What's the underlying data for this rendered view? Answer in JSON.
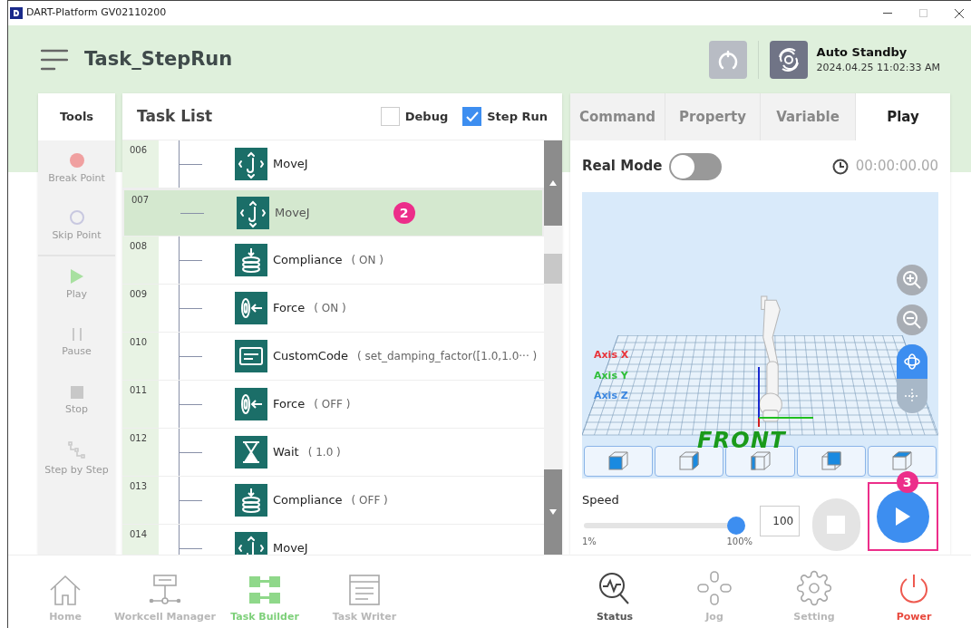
{
  "window": {
    "title": "DART-Platform GV02110200"
  },
  "header": {
    "title": "Task_StepRun",
    "status": {
      "label": "Auto Standby",
      "time": "2024.04.25 11:02:33 AM"
    }
  },
  "tools": {
    "title": "Tools",
    "items": [
      {
        "kind": "breakpoint",
        "label": "Break Point",
        "disabled": true
      },
      {
        "kind": "skippoint",
        "label": "Skip Point",
        "disabled": true
      },
      {
        "kind": "play",
        "label": "Play",
        "disabled": true
      },
      {
        "kind": "pause",
        "label": "Pause",
        "disabled": true
      },
      {
        "kind": "stop",
        "label": "Stop",
        "disabled": true
      },
      {
        "kind": "step",
        "label": "Step by Step",
        "disabled": true
      }
    ]
  },
  "task_list": {
    "title": "Task List",
    "options": [
      {
        "label": "Debug",
        "checked": false
      },
      {
        "label": "Step Run",
        "checked": true
      }
    ],
    "rows": [
      {
        "number": "006",
        "kind": "movej",
        "name": "MoveJ",
        "selected": false
      },
      {
        "number": "007",
        "kind": "movej",
        "name": "MoveJ",
        "selected": true,
        "callout": "2"
      },
      {
        "number": "008",
        "kind": "compliance",
        "name": "Compliance",
        "args": "( ON )",
        "selected": false
      },
      {
        "number": "009",
        "kind": "force",
        "name": "Force",
        "args": "( ON )",
        "selected": false
      },
      {
        "number": "010",
        "kind": "customcode",
        "name": "CustomCode",
        "args": "( set_damping_factor([1.0,1.0··· )",
        "selected": false
      },
      {
        "number": "011",
        "kind": "force",
        "name": "Force",
        "args": "( OFF )",
        "selected": false
      },
      {
        "number": "012",
        "kind": "wait",
        "name": "Wait",
        "args": "( 1.0 )",
        "selected": false
      },
      {
        "number": "013",
        "kind": "compliance",
        "name": "Compliance",
        "args": "( OFF )",
        "selected": false
      },
      {
        "number": "014",
        "kind": "movej",
        "name": "MoveJ",
        "selected": false
      }
    ]
  },
  "play_panel": {
    "tabs": [
      {
        "label": "Command",
        "selected": false
      },
      {
        "label": "Property",
        "selected": false
      },
      {
        "label": "Variable",
        "selected": false
      },
      {
        "label": "Play",
        "selected": true
      }
    ],
    "real_mode": {
      "label": "Real Mode",
      "on": false
    },
    "timer": "00:00:00.00",
    "viewport": {
      "axes": [
        {
          "label": "Axis X",
          "color": "#e8333a"
        },
        {
          "label": "Axis Y",
          "color": "#2fbf3a"
        },
        {
          "label": "Axis Z",
          "color": "#3a86e0"
        }
      ],
      "floor_label": "FRONT"
    },
    "speed": {
      "label": "Speed",
      "level": 1,
      "min_label": "1%",
      "max_label": "100%",
      "value": "100"
    },
    "play_button": {
      "callout": "3"
    }
  },
  "bottom_nav": [
    {
      "kind": "home",
      "label": "Home",
      "selected": false,
      "disabled": true
    },
    {
      "kind": "workcell",
      "label": "Workcell Manager",
      "selected": false,
      "disabled": true
    },
    {
      "kind": "taskbuilder",
      "label": "Task Builder",
      "selected": true,
      "disabled": false
    },
    {
      "kind": "taskwriter",
      "label": "Task Writer",
      "selected": false,
      "disabled": true
    },
    {
      "kind": "status",
      "label": "Status",
      "selected": false,
      "disabled": false
    },
    {
      "kind": "jog",
      "label": "Jog",
      "selected": false,
      "disabled": true
    },
    {
      "kind": "setting",
      "label": "Setting",
      "selected": false,
      "disabled": true
    },
    {
      "kind": "power",
      "label": "Power",
      "selected": false,
      "disabled": false
    }
  ]
}
